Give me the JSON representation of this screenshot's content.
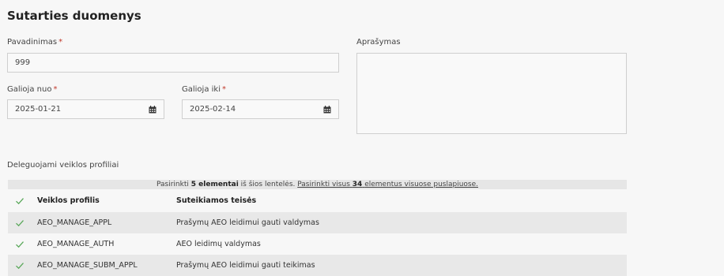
{
  "title": "Sutarties duomenys",
  "form": {
    "name_label": "Pavadinimas",
    "name_value": "999",
    "description_label": "Aprašymas",
    "valid_from_label": "Galioja nuo",
    "valid_from_value": "2025-01-21",
    "valid_to_label": "Galioja iki",
    "valid_to_value": "2025-02-14",
    "required_mark": "*"
  },
  "profiles_section": {
    "label": "Deleguojami veiklos profiliai",
    "banner": {
      "prefix": "Pasirinkti",
      "selected_count": "5 elementai",
      "middle": "iš šios lentelės.",
      "link_prefix": "Pasirinkti visus",
      "total_count": "34",
      "link_suffix": "elementus visuose puslapiuose."
    },
    "columns": [
      "Veiklos profilis",
      "Suteikiamos teisės"
    ],
    "rows": [
      {
        "profile": "AEO_MANAGE_APPL",
        "rights": "Prašymų AEO leidimui gauti valdymas",
        "checked": true
      },
      {
        "profile": "AEO_MANAGE_AUTH",
        "rights": "AEO leidimų valdymas",
        "checked": true
      },
      {
        "profile": "AEO_MANAGE_SUBM_APPL",
        "rights": "Prašymų AEO leidimui gauti teikimas",
        "checked": true
      }
    ]
  },
  "icons": {
    "calendar": "calendar-icon",
    "check": "checkmark-icon"
  },
  "colors": {
    "checkmark": "#5aa85a",
    "required": "#c0392b"
  }
}
